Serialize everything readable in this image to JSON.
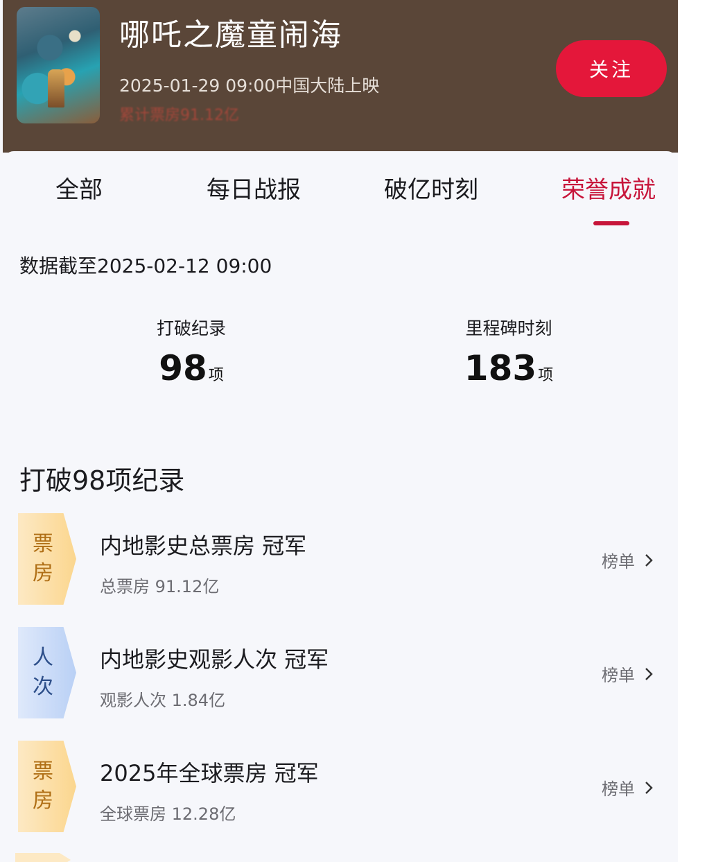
{
  "header": {
    "movie_title": "哪吒之魔童闹海",
    "release_info": "2025-01-29 09:00中国大陆上映",
    "cumulative_box_office": "累计票房91.12亿",
    "follow_label": "关注"
  },
  "tabs": [
    {
      "label": "全部",
      "active": false
    },
    {
      "label": "每日战报",
      "active": false
    },
    {
      "label": "破亿时刻",
      "active": false
    },
    {
      "label": "荣誉成就",
      "active": true
    }
  ],
  "data_as_of": "数据截至2025-02-12 09:00",
  "stats": [
    {
      "label": "打破纪录",
      "value": "98",
      "unit": "项"
    },
    {
      "label": "里程碑时刻",
      "value": "183",
      "unit": "项"
    }
  ],
  "section_title": "打破98项纪录",
  "records": [
    {
      "badge_line1": "票",
      "badge_line2": "房",
      "badge_color": "#fbd68e",
      "title": "内地影史总票房 冠军",
      "subtitle": "总票房 91.12亿",
      "link_label": "榜单"
    },
    {
      "badge_line1": "人",
      "badge_line2": "次",
      "badge_color": "#b9d0f5",
      "title": "内地影史观影人次 冠军",
      "subtitle": "观影人次 1.84亿",
      "link_label": "榜单"
    },
    {
      "badge_line1": "票",
      "badge_line2": "房",
      "badge_color": "#fbd68e",
      "title": "2025年全球票房 冠军",
      "subtitle": "全球票房 12.28亿",
      "link_label": "榜单"
    }
  ],
  "colors": {
    "header_bg": "#5a4638",
    "accent_red": "#c7153a",
    "follow_button": "#e4173a",
    "page_bg": "#f6f7fb"
  },
  "icons": {
    "chevron": "chevron-right-icon",
    "poster": "movie-poster-image"
  }
}
